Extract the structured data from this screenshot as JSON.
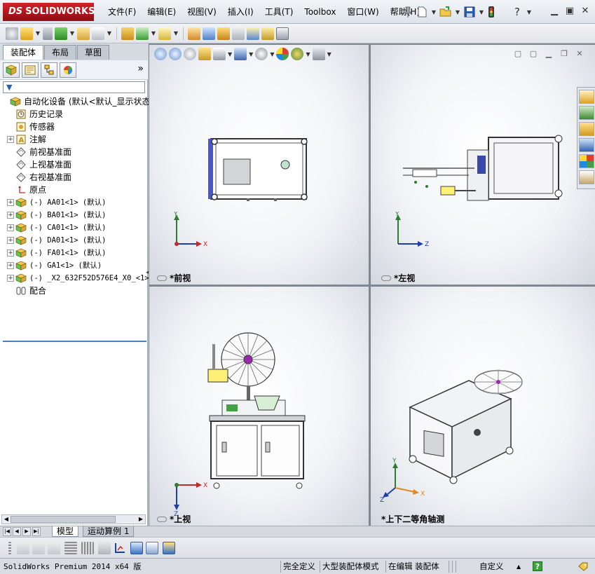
{
  "app": {
    "brand_ds": "DS",
    "brand": "SOLIDWORKS"
  },
  "menu": [
    "文件(F)",
    "编辑(E)",
    "视图(V)",
    "插入(I)",
    "工具(T)",
    "Toolbox",
    "窗口(W)",
    "帮助(H)"
  ],
  "left_panel": {
    "tabs": [
      "装配体",
      "布局",
      "草图"
    ],
    "active_tab": 0,
    "filter_label": "▼",
    "expand_label": "»",
    "tree": [
      {
        "text": "自动化设备  (默认<默认_显示状态",
        "expand": false,
        "icon": "assembly-icon",
        "mono": false,
        "indent": 0
      },
      {
        "text": "历史记录",
        "expand": false,
        "icon": "history-icon",
        "mono": false,
        "indent": 1
      },
      {
        "text": "传感器",
        "expand": false,
        "icon": "sensor-icon",
        "mono": false,
        "indent": 1
      },
      {
        "text": "注解",
        "expand": true,
        "icon": "annotation-icon",
        "mono": false,
        "indent": 1
      },
      {
        "text": "前视基准面",
        "expand": false,
        "icon": "plane-icon",
        "mono": false,
        "indent": 1
      },
      {
        "text": "上视基准面",
        "expand": false,
        "icon": "plane-icon",
        "mono": false,
        "indent": 1
      },
      {
        "text": "右视基准面",
        "expand": false,
        "icon": "plane-icon",
        "mono": false,
        "indent": 1
      },
      {
        "text": "原点",
        "expand": false,
        "icon": "origin-icon",
        "mono": false,
        "indent": 1
      },
      {
        "text": "(-) AA01<1> (默认)",
        "expand": true,
        "icon": "subassembly-icon",
        "mono": true,
        "indent": 1
      },
      {
        "text": "(-) BA01<1> (默认)",
        "expand": true,
        "icon": "subassembly-icon",
        "mono": true,
        "indent": 1
      },
      {
        "text": "(-) CA01<1> (默认)",
        "expand": true,
        "icon": "subassembly-icon",
        "mono": true,
        "indent": 1
      },
      {
        "text": "(-) DA01<1> (默认)",
        "expand": true,
        "icon": "subassembly-icon",
        "mono": true,
        "indent": 1
      },
      {
        "text": "(-) FA01<1> (默认)",
        "expand": true,
        "icon": "subassembly-icon",
        "mono": true,
        "indent": 1
      },
      {
        "text": "(-) GA1<1> (默认)",
        "expand": true,
        "icon": "subassembly-icon",
        "mono": true,
        "indent": 1
      },
      {
        "text": "(-) _X2_632F52D576E4_X0_<1>",
        "expand": true,
        "icon": "subassembly-icon",
        "mono": true,
        "indent": 1
      },
      {
        "text": "配合",
        "expand": false,
        "icon": "mates-icon",
        "mono": false,
        "indent": 1
      }
    ]
  },
  "viewports": {
    "front": {
      "label": "*前视"
    },
    "left": {
      "label": "*左视"
    },
    "top": {
      "label": "*上视"
    },
    "iso": {
      "label": "*上下二等角轴测"
    }
  },
  "axis_labels": {
    "x": "X",
    "y": "Y",
    "z": "Z"
  },
  "bottom_tabs": [
    "模型",
    "运动算例 1"
  ],
  "status_bar": {
    "version": "SolidWorks Premium 2014 x64 版",
    "state": "完全定义",
    "mode": "大型装配体模式",
    "editing": "在编辑 装配体",
    "units": "自定义",
    "units_arrow": "▲",
    "help": "?"
  },
  "colors": {
    "brand_red": "#c8102e",
    "axis_x": "#c62828",
    "axis_y": "#2e7d32",
    "axis_z": "#1e3fa8",
    "frame_blue": "#4a57c8",
    "accent_blue": "#4a7fc0"
  }
}
